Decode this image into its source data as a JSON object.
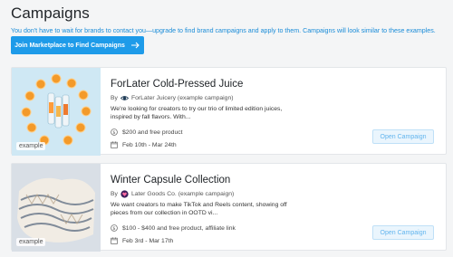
{
  "page": {
    "title": "Campaigns",
    "intro": "You don't have to wait for brands to contact you—upgrade to find brand campaigns and apply to them. Campaigns will look similar to these examples.",
    "join_button": "Join Marketplace to Find Campaigns"
  },
  "campaigns": [
    {
      "title": "ForLater Cold-Pressed Juice",
      "by_prefix": "By",
      "brand": "ForLater Juicery (example campaign)",
      "description": "We're looking for creators to try our trio of limited edition juices, inspired by fall flavors. With...",
      "compensation": "$200 and free product",
      "dates": "Feb 10th - Mar 24th",
      "open_label": "Open Campaign",
      "example_tag": "example",
      "image_icon": "juice-bottles-oranges-image"
    },
    {
      "title": "Winter Capsule Collection",
      "by_prefix": "By",
      "brand": "Later Goods Co. (example campaign)",
      "description": "We want creators to make TikTok and Reels content, showing off pieces from our collection in OOTD vi...",
      "compensation": "$100 - $400 and free product, affiliate link",
      "dates": "Feb 3rd - Mar 17th",
      "open_label": "Open Campaign",
      "example_tag": "example",
      "image_icon": "knit-sweater-image"
    }
  ],
  "colors": {
    "accent": "#1e9be9",
    "intro_text": "#1a8cd8",
    "open_button_text": "#62b5ee",
    "open_button_bg": "#eaf5fd"
  }
}
